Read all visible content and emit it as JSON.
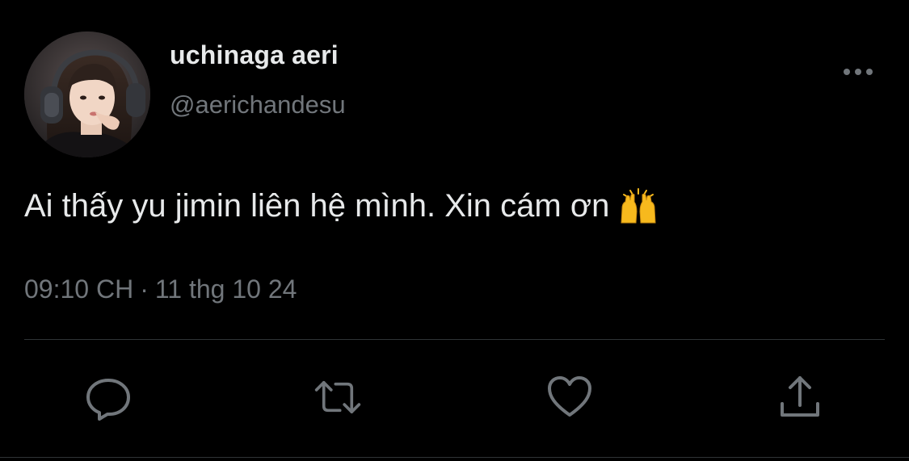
{
  "author": {
    "display_name": "uchinaga aeri",
    "handle": "@aerichandesu",
    "avatar_icon": "profile-photo"
  },
  "tweet": {
    "text": "Ai thấy yu jimin liên hệ mình. Xin cám ơn",
    "emoji": "raising-hands-emoji",
    "time": "09:10 CH",
    "separator": "·",
    "date": "11 thg 10 24"
  },
  "actions": {
    "reply_icon": "reply-icon",
    "retweet_icon": "retweet-icon",
    "like_icon": "heart-icon",
    "share_icon": "share-icon",
    "more_icon": "more-icon"
  },
  "colors": {
    "background": "#000000",
    "primary_text": "#e7e9ea",
    "secondary_text": "#71767b",
    "divider": "#2f3336",
    "emoji_yellow": "#f7b91d"
  }
}
